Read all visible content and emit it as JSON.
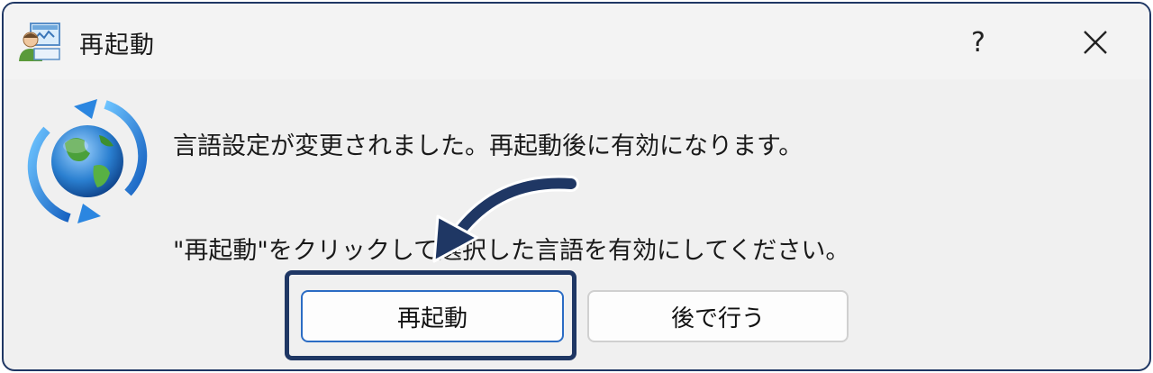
{
  "window": {
    "title": "再起動",
    "help_label": "?",
    "icons": {
      "app": "app-users-icon",
      "close": "close-icon",
      "content": "globe-refresh-icon"
    }
  },
  "message": {
    "line1": "言語設定が変更されました。再起動後に有効になります。",
    "line2": "\"再起動\"をクリックして選択した言語を有効にしてください。"
  },
  "buttons": {
    "restart_label": "再起動",
    "later_label": "後で行う"
  },
  "colors": {
    "annotation": "#1f3764",
    "focus_border": "#2b6cc4",
    "dialog_bg": "#f0f0f0"
  }
}
